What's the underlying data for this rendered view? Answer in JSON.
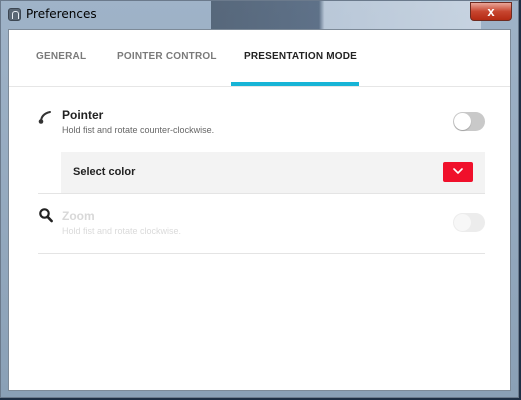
{
  "window": {
    "title": "Preferences",
    "close_glyph": "x"
  },
  "tabs": [
    {
      "label": "GENERAL",
      "active": false
    },
    {
      "label": "POINTER CONTROL",
      "active": false
    },
    {
      "label": "PRESENTATION MODE",
      "active": true
    }
  ],
  "settings": {
    "pointer": {
      "title": "Pointer",
      "description": "Hold fist and rotate counter-clockwise.",
      "icon": "pointer-icon",
      "enabled": false,
      "disabled_state": false
    },
    "select_color": {
      "label": "Select color",
      "color": "#f0102b",
      "icon": "chevron-down-icon"
    },
    "zoom": {
      "title": "Zoom",
      "description": "Hold fist and rotate clockwise.",
      "icon": "search-icon",
      "enabled": false,
      "disabled_state": true
    }
  },
  "colors": {
    "accent": "#17b4d6",
    "pointer_color": "#f0102b"
  }
}
